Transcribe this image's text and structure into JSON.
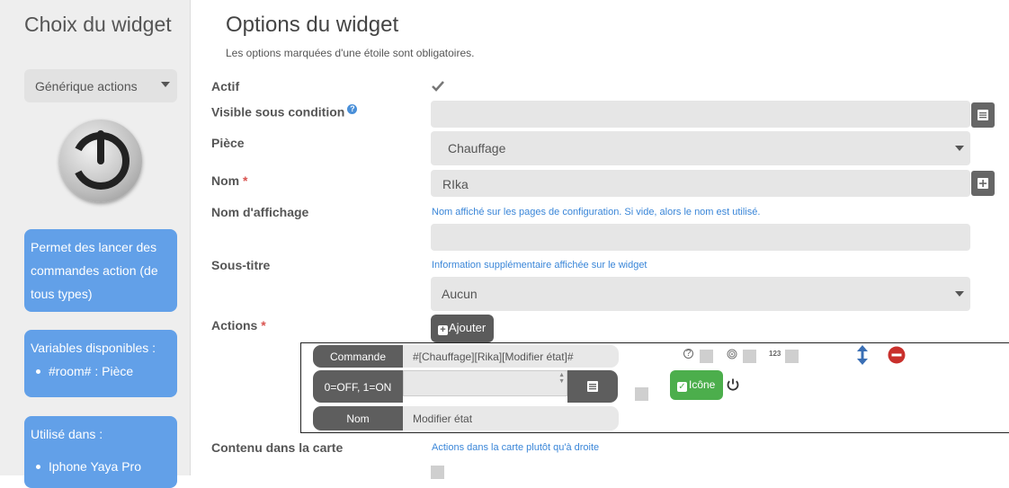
{
  "sidebar": {
    "title": "Choix du widget",
    "widget_select": "Générique actions",
    "description": "Permet des lancer des commandes action (de tous types)",
    "variables_title": "Variables disponibles :",
    "variables": [
      "#room# : Pièce"
    ],
    "used_in_title": "Utilisé dans :",
    "used_in": [
      "Iphone Yaya Pro"
    ]
  },
  "main": {
    "title": "Options du widget",
    "subtitle": "Les options marquées d'une étoile sont obligatoires.",
    "actif_label": "Actif",
    "actif_checked": true,
    "visible_label": "Visible sous condition",
    "visible_value": "",
    "piece_label": "Pièce",
    "piece_value": "Chauffage",
    "nom_label": "Nom",
    "nom_value": "RIka",
    "nom_affichage_label": "Nom d'affichage",
    "nom_affichage_hint": "Nom affiché sur les pages de configuration. Si vide, alors le nom est utilisé.",
    "nom_affichage_value": "",
    "sous_titre_label": "Sous-titre",
    "sous_titre_hint": "Information supplémentaire affichée sur le widget",
    "sous_titre_value": "Aucun",
    "actions_label": "Actions",
    "add_label": "Ajouter",
    "contenu_label": "Contenu dans la carte",
    "contenu_hint": "Actions dans la carte plutôt qu'à droite",
    "required_mark": "*"
  },
  "action": {
    "commande_label": "Commande",
    "commande_value": "#[Chauffage][Rika][Modifier état]#",
    "value_label": "0=OFF, 1=ON",
    "value_value": "",
    "nom_label": "Nom",
    "nom_value": "Modifier état",
    "icone_label": "Icône",
    "num_badge": "123"
  },
  "colors": {
    "sidebar_bg": "#eeeeee",
    "info_blue": "#62a0e8",
    "link_blue": "#3a86d8",
    "required_red": "#d9534f",
    "icone_green": "#4cae4c",
    "dark_gray": "#5e5e5e"
  },
  "icons": [
    "chevron-down-icon",
    "power-icon",
    "help-icon",
    "list-icon",
    "plus-icon",
    "check-icon",
    "question-circle-icon",
    "fingerprint-icon",
    "sort-vertical-icon",
    "remove-circle-icon"
  ]
}
